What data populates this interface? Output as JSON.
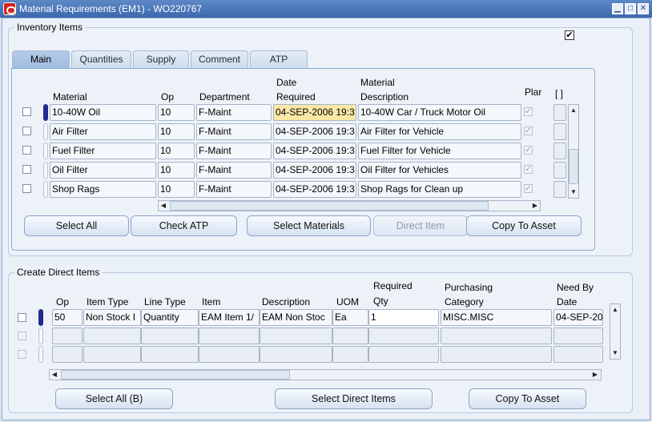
{
  "window": {
    "title": "Material Requirements (EM1) - WO220767",
    "minimize": "▁",
    "maximize": "□",
    "close": "✕"
  },
  "inventory": {
    "group_label": "Inventory Items",
    "top_check": "✔",
    "tabs": [
      "Main",
      "Quantities",
      "Supply",
      "Comment",
      "ATP"
    ],
    "headers": {
      "material": "Material",
      "op": "Op",
      "department": "Department",
      "date_required": [
        "Date",
        "Required"
      ],
      "material_description": [
        "Material",
        "Description"
      ],
      "planned": "Plar",
      "bracket": "[ ]"
    },
    "rows": [
      {
        "material": "10-40W Oil",
        "op": "10",
        "department": "F-Maint",
        "date": "04-SEP-2006 19:3",
        "description": "10-40W Car / Truck Motor Oil"
      },
      {
        "material": "Air Filter",
        "op": "10",
        "department": "F-Maint",
        "date": "04-SEP-2006 19:3",
        "description": "Air Filter for Vehicle"
      },
      {
        "material": "Fuel Filter",
        "op": "10",
        "department": "F-Maint",
        "date": "04-SEP-2006 19:3",
        "description": "Fuel Filter for Vehicle"
      },
      {
        "material": "Oil Filter",
        "op": "10",
        "department": "F-Maint",
        "date": "04-SEP-2006 19:3",
        "description": "Oil Filter for Vehicles"
      },
      {
        "material": "Shop Rags",
        "op": "10",
        "department": "F-Maint",
        "date": "04-SEP-2006 19:3",
        "description": "Shop Rags for Clean up"
      }
    ],
    "buttons": {
      "select_all": "Select All",
      "check_atp": "Check ATP",
      "select_materials": "Select Materials",
      "direct_item": "Direct Item",
      "copy_to_asset": "Copy To Asset"
    }
  },
  "direct": {
    "group_label": "Create Direct Items",
    "headers": {
      "op": "Op",
      "item_type": "Item Type",
      "line_type": "Line Type",
      "item": "Item",
      "description": "Description",
      "uom": "UOM",
      "required_qty": [
        "Required",
        "Qty"
      ],
      "purchasing_category": [
        "Purchasing",
        "Category"
      ],
      "need_by_date": [
        "Need By",
        "Date"
      ]
    },
    "rows": [
      {
        "op": "50",
        "item_type": "Non Stock I",
        "line_type": "Quantity",
        "item": "EAM Item 1/",
        "description": "EAM Non Stoc",
        "uom": "Ea",
        "qty": "1",
        "category": "MISC.MISC",
        "need_by": "04-SEP-20"
      }
    ],
    "buttons": {
      "select_all": "Select All (B)",
      "select_direct_items": "Select Direct Items",
      "copy_to_asset": "Copy To Asset"
    }
  },
  "scroll": {
    "up": "▲",
    "down": "▼",
    "left": "◀",
    "right": "▶"
  }
}
